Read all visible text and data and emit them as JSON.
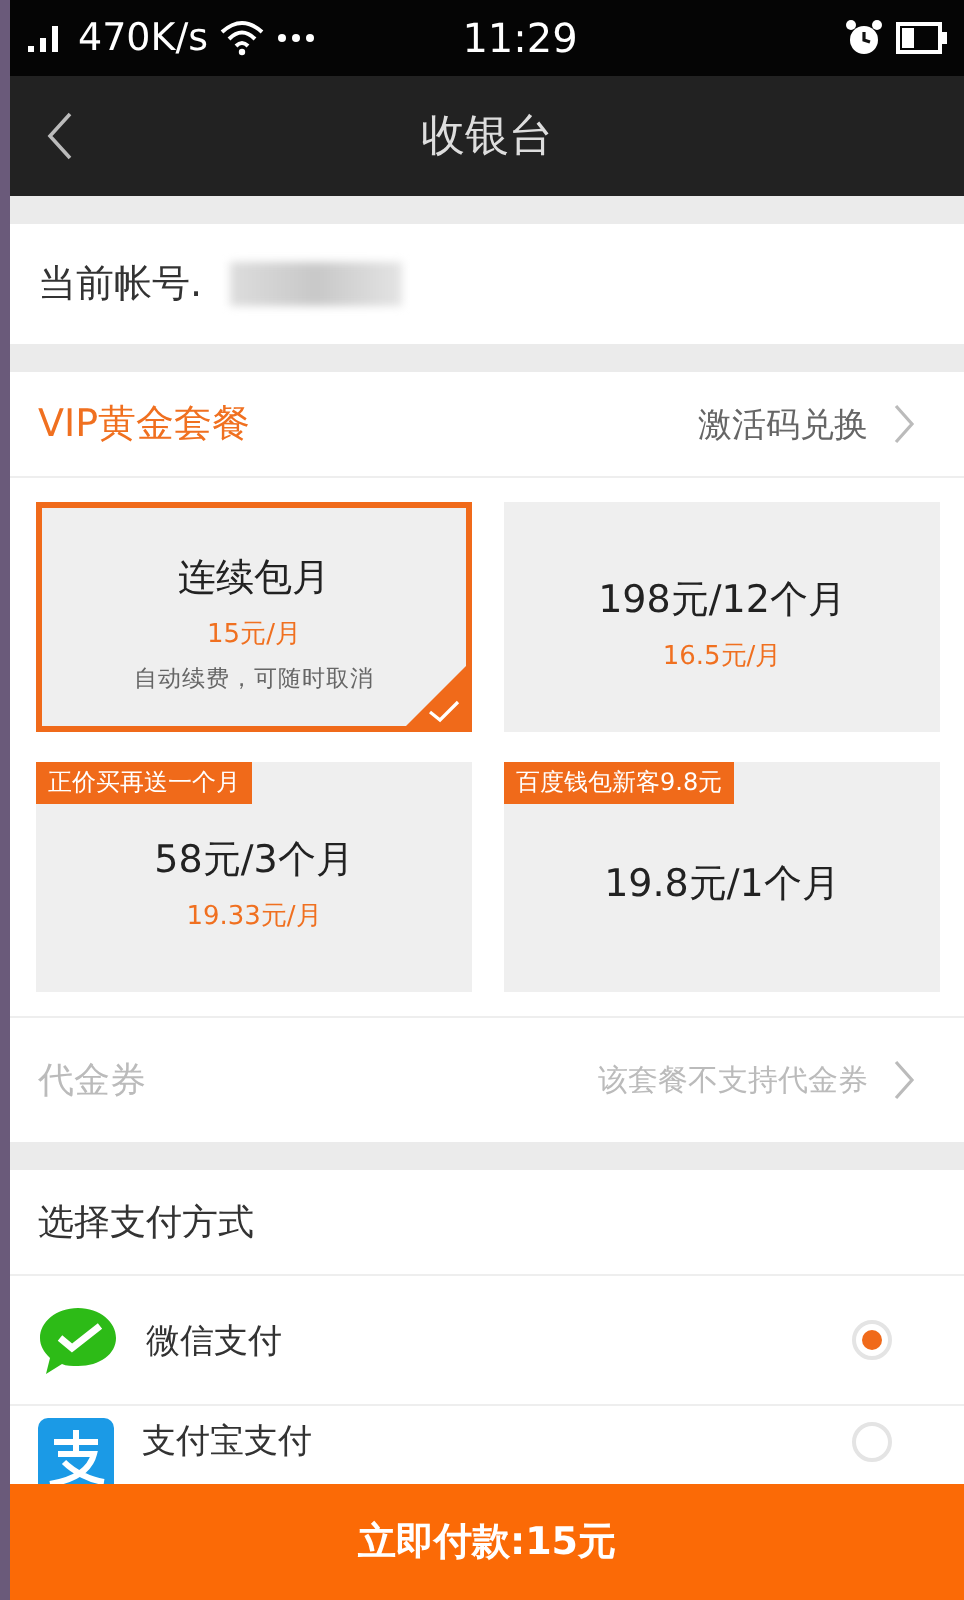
{
  "status_bar": {
    "speed": "470K/s",
    "time": "11:29"
  },
  "nav": {
    "title": "收银台"
  },
  "account": {
    "label": "当前帐号."
  },
  "package": {
    "title": "VIP黄金套餐",
    "link": "激活码兑换"
  },
  "plans": [
    {
      "title": "连续包月",
      "price": "15元/月",
      "note": "自动续费，可随时取消",
      "selected": true
    },
    {
      "title": "198元/12个月",
      "price": "16.5元/月",
      "selected": false
    },
    {
      "title": "58元/3个月",
      "price": "19.33元/月",
      "badge": "正价买再送一个月",
      "selected": false
    },
    {
      "title": "19.8元/1个月",
      "badge": "百度钱包新客9.8元",
      "selected": false
    }
  ],
  "voucher": {
    "label": "代金券",
    "value": "该套餐不支持代金券",
    "disabled": true
  },
  "payment": {
    "title": "选择支付方式",
    "methods": [
      {
        "kind": "wechat",
        "label": "微信支付",
        "selected": true
      },
      {
        "kind": "alipay",
        "label": "支付宝支付",
        "selected": false
      }
    ]
  },
  "pay_button": "立即付款:15元"
}
